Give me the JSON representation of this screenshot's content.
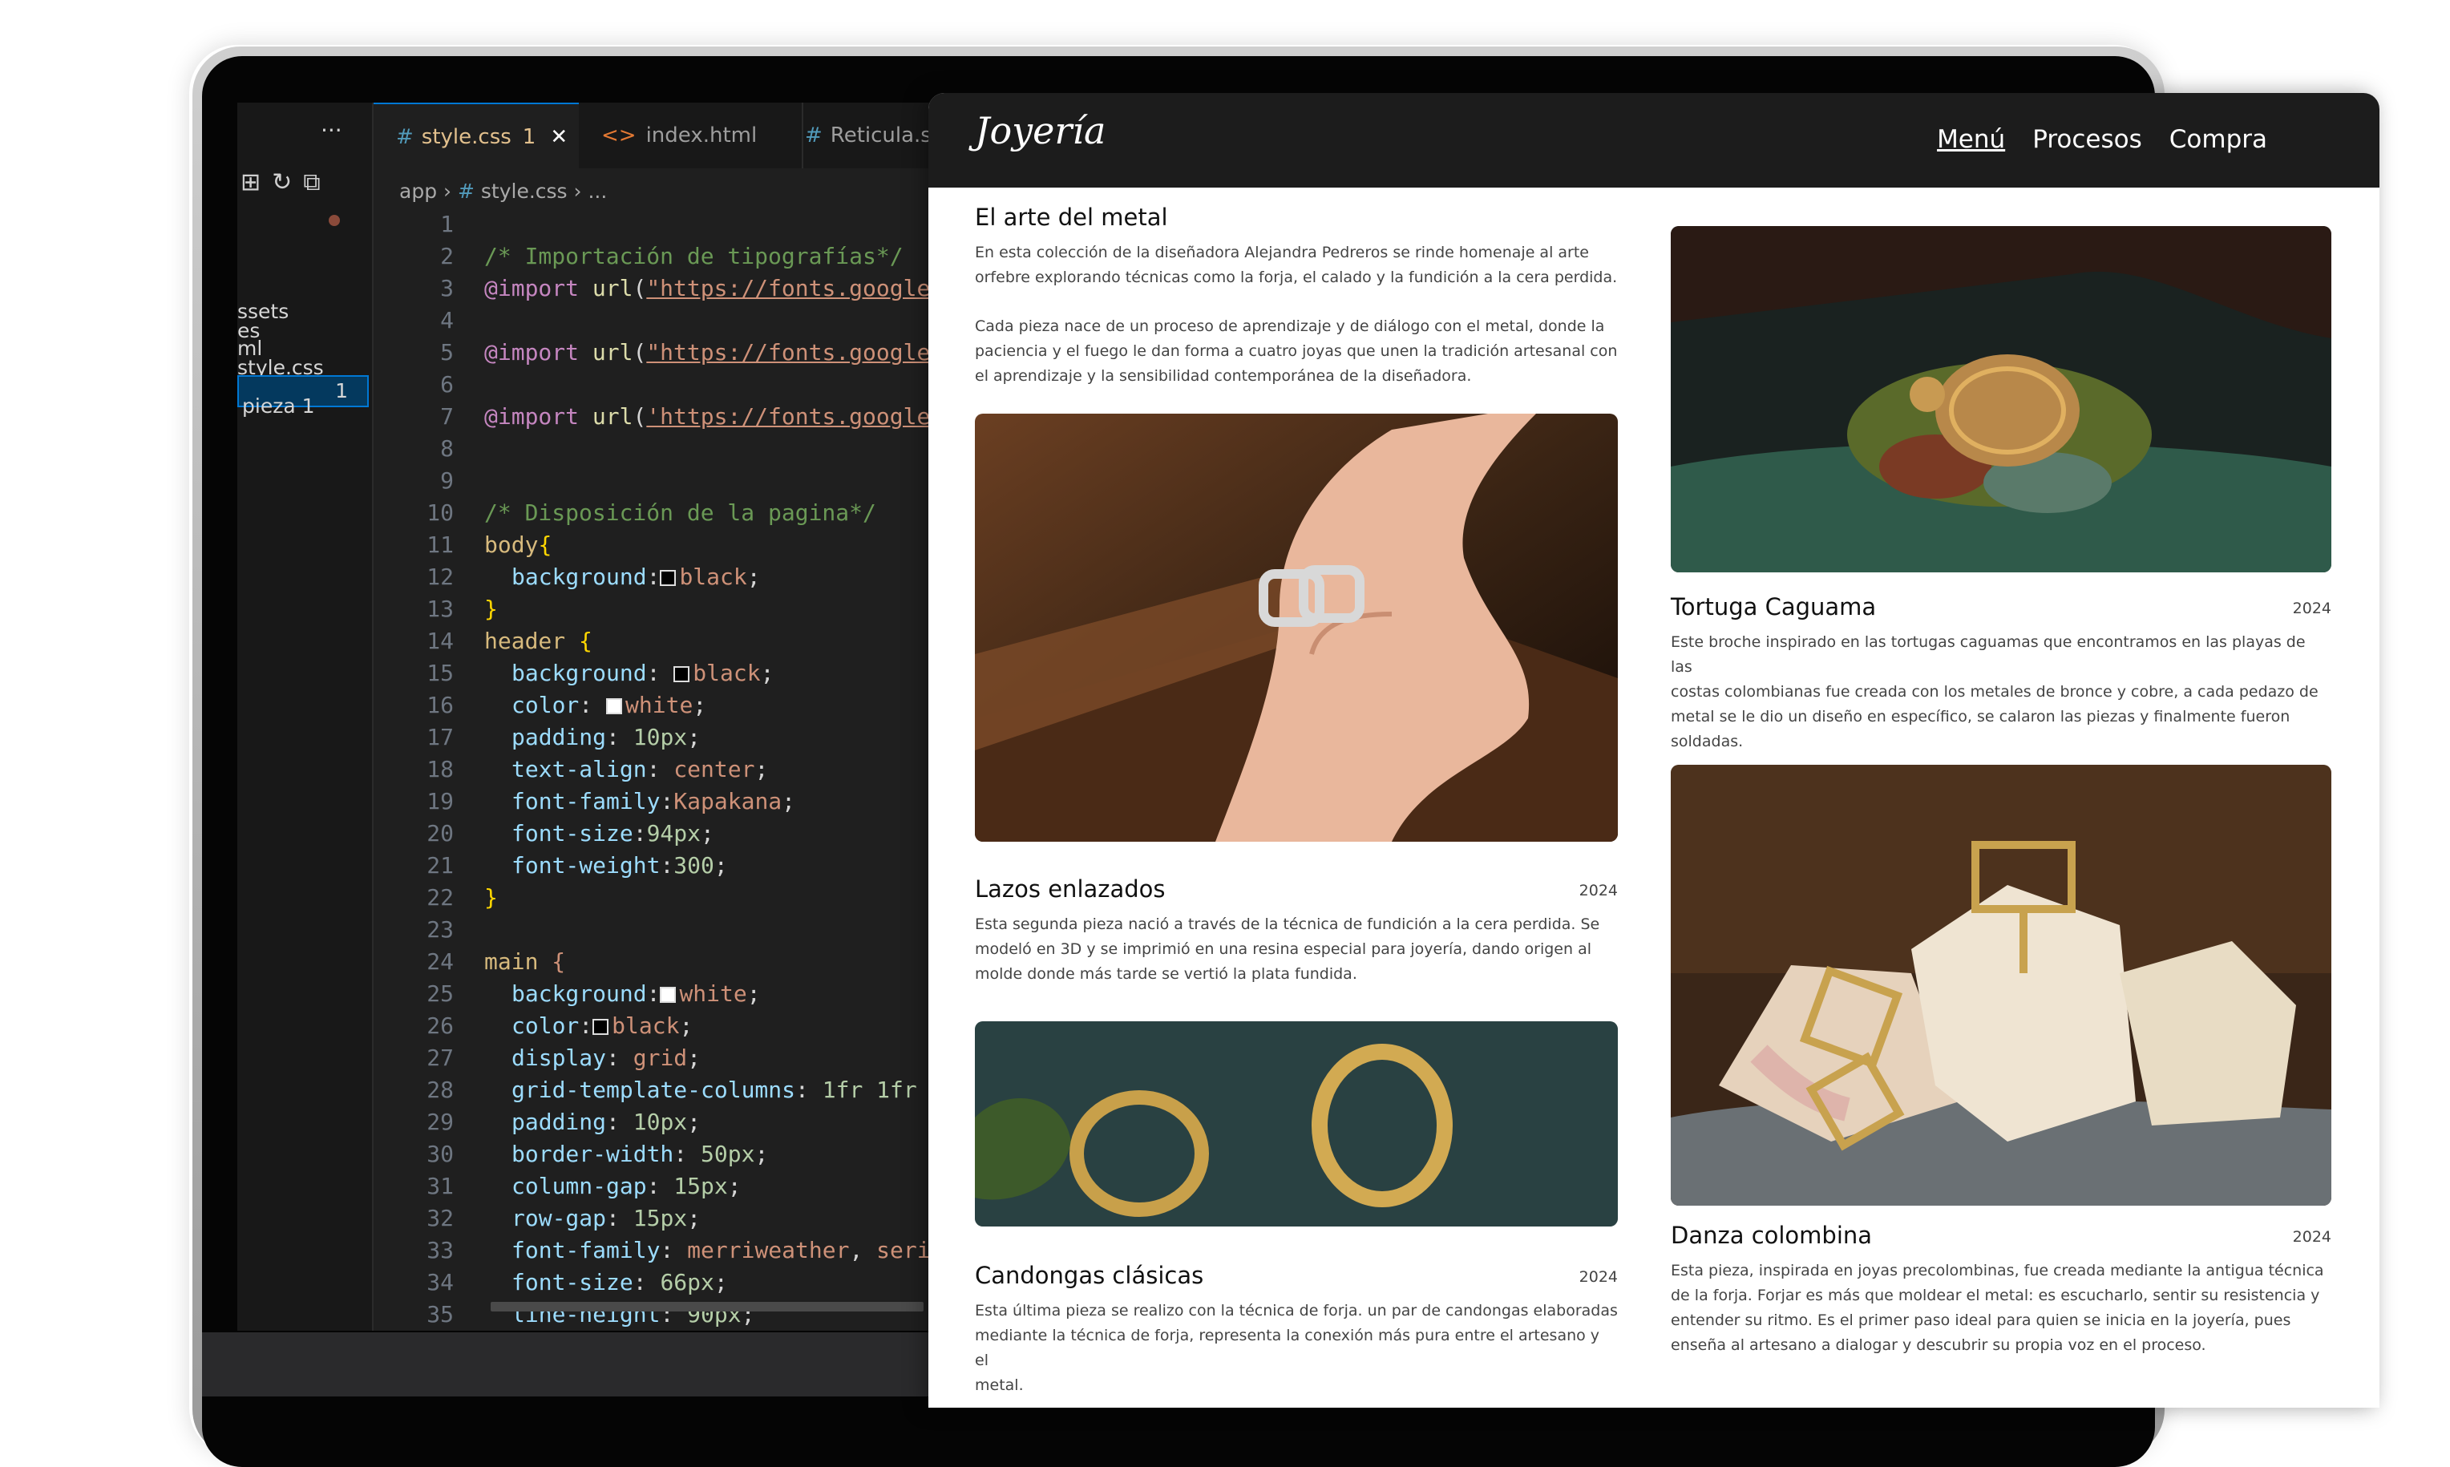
{
  "editor": {
    "explorer": {
      "items": [
        "ssets",
        "es",
        "ml",
        "style.css"
      ],
      "badge": "1",
      "last_item": "pieza 1"
    },
    "tabs": [
      {
        "label": "style.css",
        "count": "1",
        "active": true
      },
      {
        "label": "index.html",
        "active": false
      },
      {
        "label": "Reticula.s",
        "active": false
      }
    ],
    "breadcrumb": {
      "folder": "app",
      "file": "style.css",
      "more": "..."
    }
  },
  "site": {
    "logo": "Joyería",
    "nav": [
      "Menú",
      "Procesos",
      "Compra"
    ],
    "intro": {
      "title": "El arte del metal",
      "p1_line1": "En esta colección de la diseñadora Alejandra Pedreros se rinde homenaje al arte",
      "p1_line2": "orfebre explorando técnicas como la forja, el calado y la fundición a la cera perdida.",
      "p2_line1": "Cada pieza nace de un proceso de aprendizaje y de diálogo con el metal, donde la",
      "p2_line2": "paciencia y el fuego le dan forma a cuatro joyas que unen la tradición artesanal con",
      "p2_line3": "el aprendizaje y la sensibilidad contemporánea de la diseñadora."
    },
    "pieces": [
      {
        "title": "Lazos enlazados",
        "year": "2024",
        "lines": [
          "Esta segunda pieza nació a través de la técnica de fundición a la cera perdida. Se",
          "modeló en 3D y se imprimió en una resina especial para joyería, dando origen al",
          "molde donde más tarde se vertió la plata fundida."
        ]
      },
      {
        "title": "Candongas clásicas",
        "year": "2024",
        "lines": [
          "Esta última pieza se realizo con la técnica de forja. un par de candongas elaboradas",
          "mediante la técnica de forja, representa la conexión más pura entre el artesano y el",
          "metal."
        ]
      },
      {
        "title": "Tortuga Caguama",
        "year": "2024",
        "lines": [
          "Este broche inspirado en las tortugas caguamas que encontramos en las playas de las",
          "costas colombianas fue creada con los metales de bronce y cobre, a cada pedazo de",
          "metal se le dio un diseño en específico, se calaron las piezas y finalmente fueron",
          "soldadas."
        ]
      },
      {
        "title": "Danza colombina",
        "year": "2024",
        "lines": [
          "Esta pieza, inspirada en joyas precolombinas, fue creada mediante la antigua técnica",
          "de la forja. Forjar es más que moldear el metal: es escucharlo, sentir su resistencia y",
          "entender su ritmo.  Es el primer paso ideal para quien se inicia en la joyería, pues",
          "enseña al artesano a dialogar y descubrir su propia voz en el proceso."
        ]
      }
    ]
  }
}
